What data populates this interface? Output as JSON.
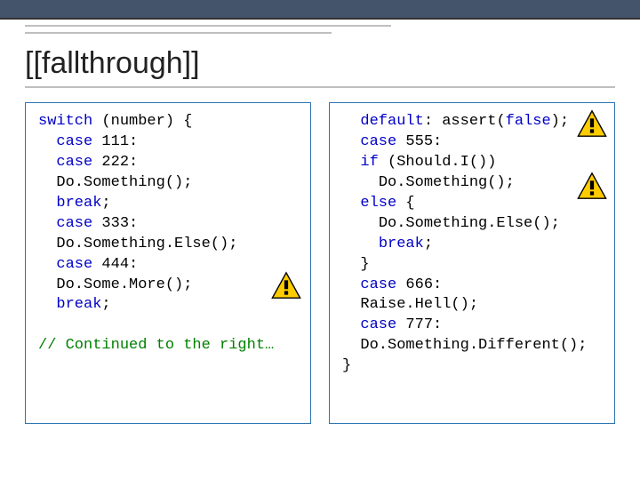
{
  "title": "[[fallthrough]]",
  "left": {
    "kw_switch": "switch",
    "paren_open": " (number) {",
    "kw_case1": "case",
    "val1": " 111:",
    "kw_case2": "case",
    "val2": " 222:",
    "line_do1": "Do.Something();",
    "kw_break1": "break",
    "semi1": ";",
    "kw_case3": "case",
    "val3": " 333:",
    "line_do2": "Do.Something.Else();",
    "kw_case4": "case",
    "val4": " 444:",
    "line_do3": "Do.Some.More();",
    "kw_break2": "break",
    "semi2": ";",
    "comment": "// Continued to the right…"
  },
  "right": {
    "kw_default": "default",
    "colon_sp": ": assert(",
    "kw_false": "false",
    "close_assert": ");",
    "kw_case5": "case",
    "val5": " 555:",
    "kw_if": "if",
    "if_cond": " (Should.I())",
    "line_do4": "Do.Something();",
    "kw_else": "else",
    "brace_open": " {",
    "line_do5": "Do.Something.Else();",
    "kw_break3": "break",
    "semi3": ";",
    "brace_close": "}",
    "kw_case6": "case",
    "val6": " 666:",
    "line_raise": "Raise.Hell();",
    "kw_case7": "case",
    "val7": " 777:",
    "line_do6": "Do.Something.Different();",
    "closing": "}"
  }
}
